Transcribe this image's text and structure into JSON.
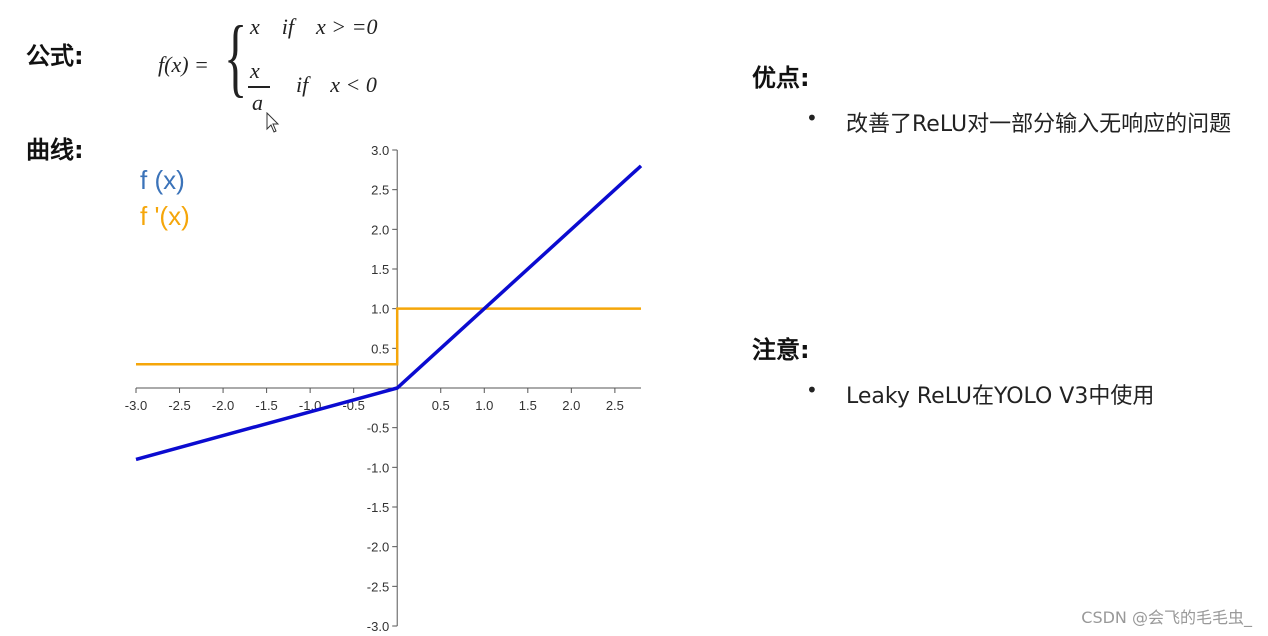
{
  "headings": {
    "formula": "公式:",
    "curve": "曲线:",
    "advantages": "优点:",
    "notes": "注意:"
  },
  "formula": {
    "lhs": "f(x) =",
    "case1": "x    if    x > =0",
    "case2_num": "x",
    "case2_den": "a",
    "case2_cond": "if    x < 0"
  },
  "advantages": [
    "改善了ReLU对一部分输入无响应的问题"
  ],
  "notes": [
    "Leaky ReLU在YOLO V3中使用"
  ],
  "watermark": "CSDN @会飞的毛毛虫_",
  "colors": {
    "fx": "#0b0bd0",
    "dfx": "#f5a60a",
    "legend_fx": "#3b73b9",
    "legend_dfx": "#f5a60a",
    "axis": "#555555"
  },
  "chart_data": {
    "type": "line",
    "title": "",
    "xlabel": "",
    "ylabel": "",
    "xlim": [
      -3.0,
      2.8
    ],
    "ylim": [
      -3.0,
      3.0
    ],
    "x_ticks": [
      "-3.0",
      "-2.5",
      "-2.0",
      "-1.5",
      "-1.0",
      "-0.5",
      "0.5",
      "1.0",
      "1.5",
      "2.0",
      "2.5"
    ],
    "y_ticks": [
      "3.0",
      "2.5",
      "2.0",
      "1.5",
      "1.0",
      "0.5",
      "-0.5",
      "-1.0",
      "-1.5",
      "-2.0",
      "-2.5",
      "-3.0"
    ],
    "legend": {
      "position": "top-left",
      "entries": [
        "f (x)",
        "f '(x)"
      ]
    },
    "grid": false,
    "series": [
      {
        "name": "f (x)",
        "points": [
          [
            -3.0,
            -0.9
          ],
          [
            0.0,
            0.0
          ],
          [
            2.8,
            2.8
          ]
        ]
      },
      {
        "name": "f '(x)",
        "points": [
          [
            -3.0,
            0.3
          ],
          [
            0.0,
            0.3
          ],
          [
            0.0,
            1.0
          ],
          [
            2.8,
            1.0
          ]
        ]
      }
    ]
  }
}
